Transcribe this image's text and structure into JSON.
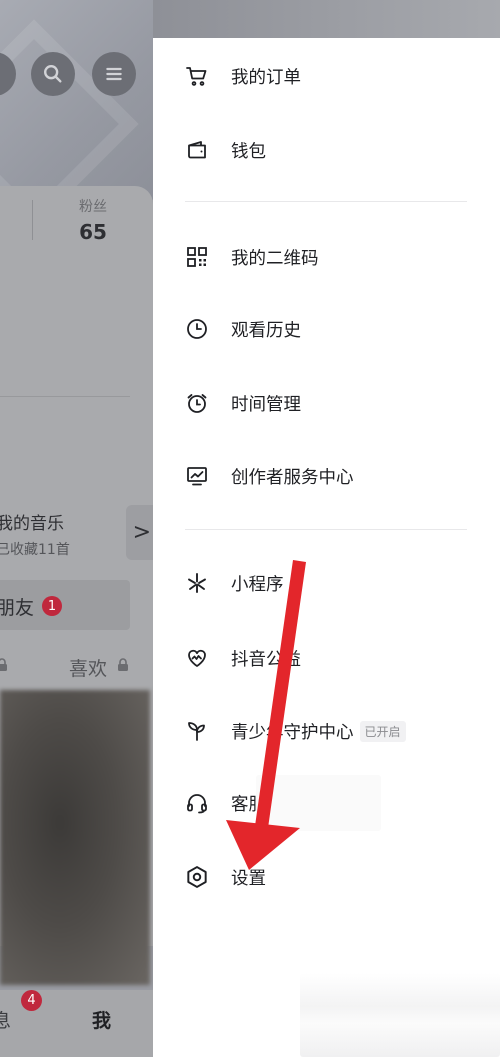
{
  "background": {
    "fans_label": "粉丝",
    "fans_count": "65",
    "music_title": "我的音乐",
    "music_sub": "已收藏11首",
    "music_arrow": ">",
    "friends_label": "朋友",
    "friends_badge": "1",
    "like_label": "喜欢",
    "nav_message_label": "息",
    "nav_message_badge": "4",
    "nav_me_label": "我"
  },
  "drawer": {
    "items": [
      {
        "icon": "cart-icon",
        "label": "我的订单"
      },
      {
        "icon": "wallet-icon",
        "label": "钱包"
      },
      {
        "icon": "qrcode-icon",
        "label": "我的二维码"
      },
      {
        "icon": "clock-icon",
        "label": "观看历史"
      },
      {
        "icon": "alarm-icon",
        "label": "时间管理"
      },
      {
        "icon": "chart-icon",
        "label": "创作者服务中心"
      },
      {
        "icon": "asterisk-icon",
        "label": "小程序"
      },
      {
        "icon": "heart-icon",
        "label": "抖音公益"
      },
      {
        "icon": "sprout-icon",
        "label": "青少年守护中心",
        "tag": "已开启"
      },
      {
        "icon": "headset-icon",
        "label": "客服"
      },
      {
        "icon": "settings-icon",
        "label": "设置"
      }
    ]
  },
  "colors": {
    "annotation_arrow": "#e3262b",
    "badge": "#c0283d",
    "text": "#1f2024"
  }
}
